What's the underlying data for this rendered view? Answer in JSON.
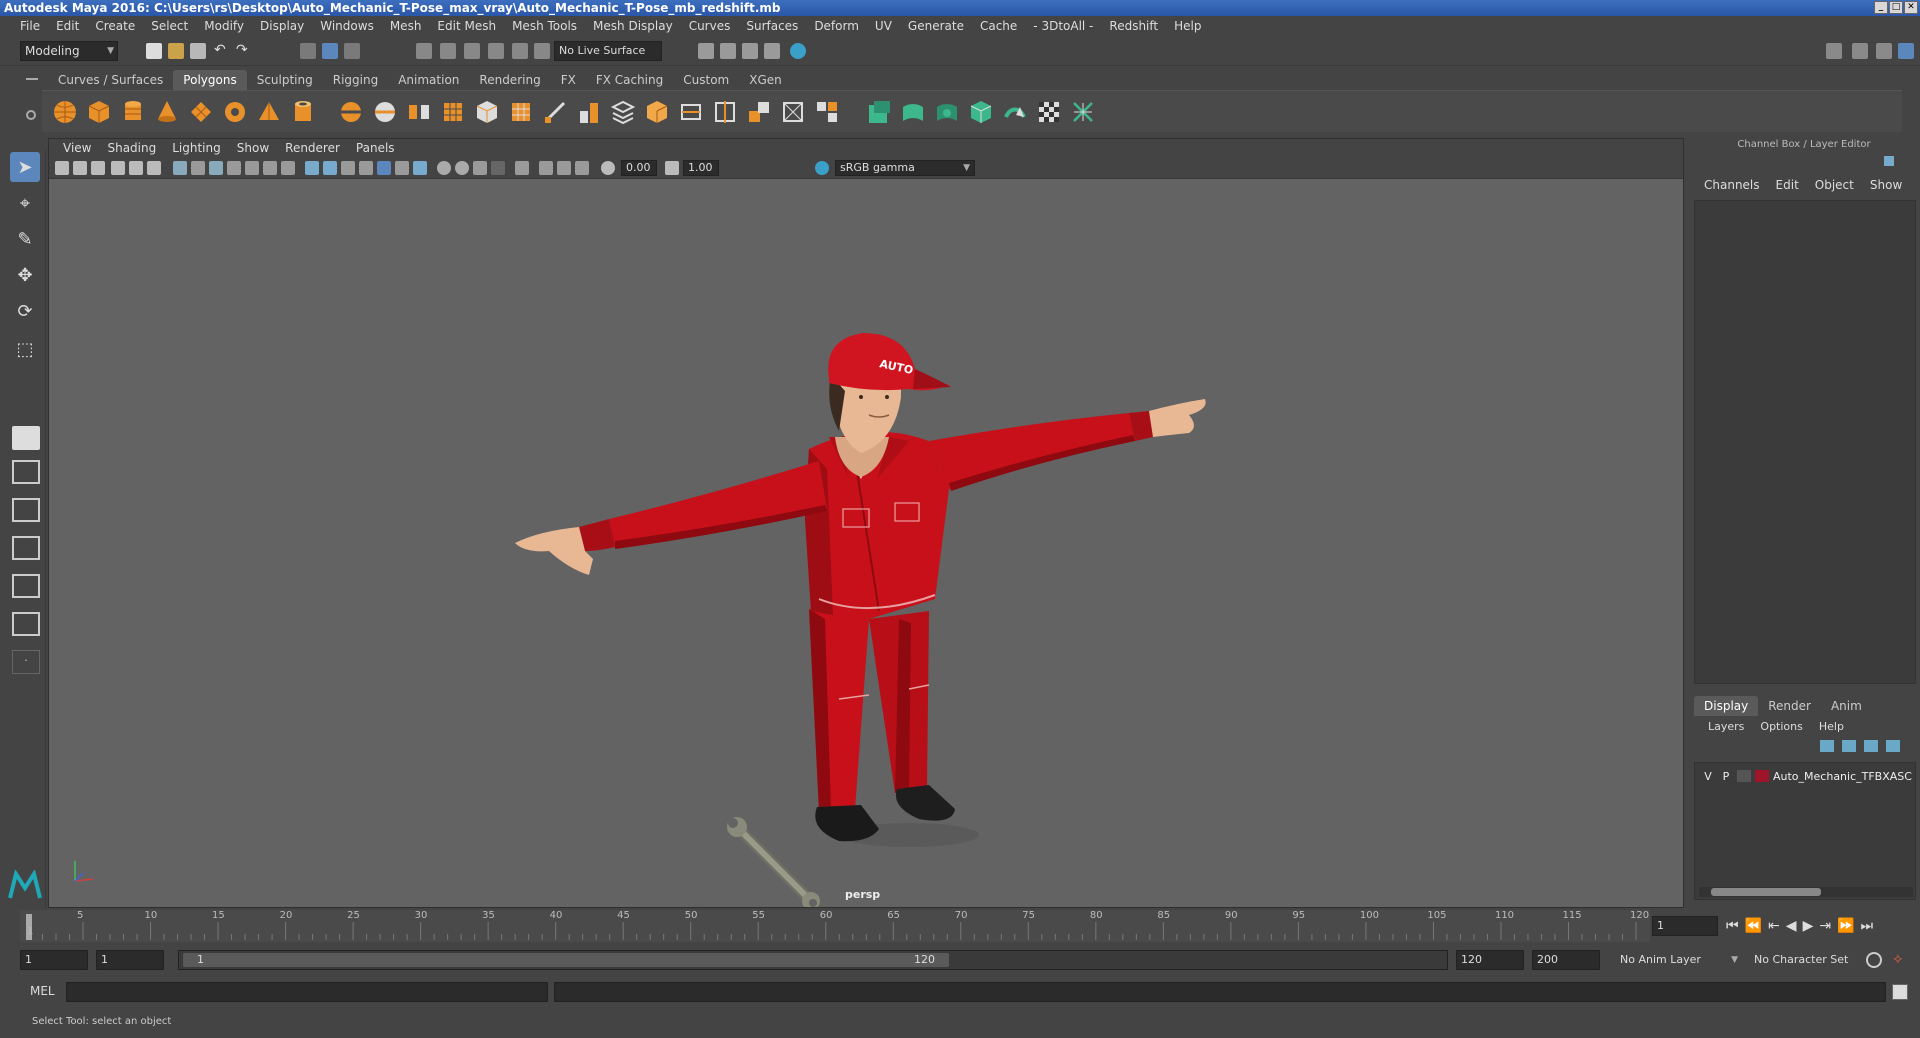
{
  "window": {
    "title": "Autodesk Maya 2016: C:\\Users\\rs\\Desktop\\Auto_Mechanic_T-Pose_max_vray\\Auto_Mechanic_T-Pose_mb_redshift.mb",
    "controls": [
      "_",
      "□",
      "✕"
    ]
  },
  "menubar": {
    "items": [
      "File",
      "Edit",
      "Create",
      "Select",
      "Modify",
      "Display",
      "Windows",
      "Mesh",
      "Edit Mesh",
      "Mesh Tools",
      "Mesh Display",
      "Curves",
      "Surfaces",
      "Deform",
      "UV",
      "Generate",
      "Cache",
      "- 3DtoAll -",
      "Redshift",
      "Help"
    ]
  },
  "statusline": {
    "mode": "Modeling",
    "live_surface": "No Live Surface"
  },
  "shelf": {
    "tabs": [
      "Curves / Surfaces",
      "Polygons",
      "Sculpting",
      "Rigging",
      "Animation",
      "Rendering",
      "FX",
      "FX Caching",
      "Custom",
      "XGen"
    ],
    "active_tab": "Polygons"
  },
  "panel": {
    "menu": [
      "View",
      "Shading",
      "Lighting",
      "Show",
      "Renderer",
      "Panels"
    ],
    "exposure": "0.00",
    "gamma": "1.00",
    "color_space": "sRGB gamma",
    "camera": "persp"
  },
  "scene": {
    "cap_text": "AUTO",
    "colors": {
      "suit": "#c8101a",
      "suit_dark": "#8e0a10",
      "skin": "#e8b894",
      "shoe": "#1a1a1a",
      "wrench": "#8a8a7a",
      "viewport_bg": "#636363"
    }
  },
  "channel_box": {
    "title": "Channel Box / Layer Editor",
    "menu": [
      "Channels",
      "Edit",
      "Object",
      "Show"
    ]
  },
  "layer_editor": {
    "tabs": [
      "Display",
      "Render",
      "Anim"
    ],
    "active_tab": "Display",
    "menu": [
      "Layers",
      "Options",
      "Help"
    ],
    "layers": [
      {
        "v": "V",
        "p": "P",
        "name": "Auto_Mechanic_TFBXASC",
        "color": "#a0142a"
      }
    ]
  },
  "timeslider": {
    "ticks": [
      "1",
      "5",
      "10",
      "15",
      "20",
      "25",
      "30",
      "35",
      "40",
      "45",
      "50",
      "55",
      "60",
      "65",
      "70",
      "75",
      "80",
      "85",
      "90",
      "95",
      "100",
      "105",
      "110",
      "115",
      "120"
    ],
    "current_frame": "1"
  },
  "rangebar": {
    "start": "1",
    "anim_start": "1",
    "slider_start": "1",
    "slider_end": "120",
    "anim_end": "120",
    "end": "200",
    "anim_layer": "No Anim Layer",
    "character_set": "No Character Set"
  },
  "cmdline": {
    "label": "MEL"
  },
  "helpline": {
    "text": "Select Tool: select an object"
  }
}
